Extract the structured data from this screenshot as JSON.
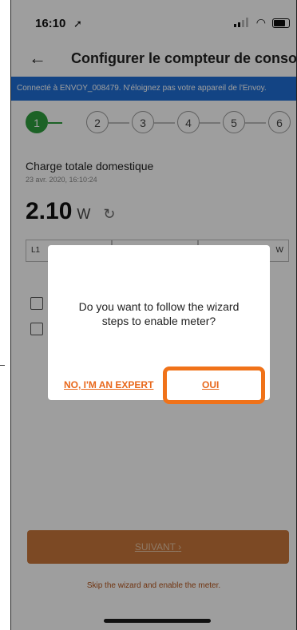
{
  "status_bar": {
    "time": "16:10",
    "location_icon": "location-arrow-icon",
    "signal_icon": "signal-icon",
    "wifi_icon": "wifi-icon",
    "battery_icon": "battery-icon"
  },
  "header": {
    "back_icon": "back-arrow-icon",
    "title": "Configurer le compteur de consom"
  },
  "banner": {
    "text": "Connecté à ENVOY_008479. N'éloignez pas votre appareil de l'Envoy."
  },
  "stepper": {
    "steps": [
      "1",
      "2",
      "3",
      "4",
      "5",
      "6"
    ],
    "active_index": 0,
    "active_color": "#2e9e3e"
  },
  "consumption": {
    "title": "Charge totale domestique",
    "date": "23 avr. 2020, 16:10:24",
    "value": "2.10",
    "unit": "W",
    "refresh_icon": "refresh-icon",
    "phases": [
      "L1",
      "",
      "W"
    ]
  },
  "dialog": {
    "message": "Do you want to follow the wizard steps to enable meter?",
    "expert_label": "NO, I'M AN EXPERT",
    "yes_label": "OUI",
    "accent_color": "#e8671a",
    "highlight_color": "#f07219"
  },
  "footer": {
    "next_label": "SUIVANT",
    "next_icon": "chevron-right-icon",
    "skip_text": "Skip the wizard and enable the meter."
  }
}
